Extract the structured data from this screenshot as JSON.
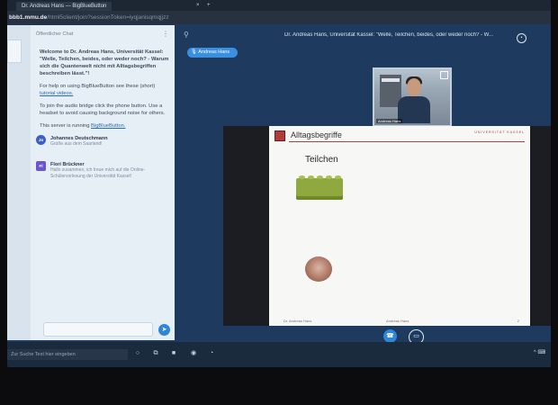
{
  "browser": {
    "tab_title": "Dr. Andreas Hans — BigBlueButton",
    "tab_close": "×",
    "new_tab": "+",
    "url_host": "bbb1.mmu.de",
    "url_path": "/html5client/join?sessionToken=iyqjanisqmqjjzz"
  },
  "chat": {
    "header": "Öffentlicher Chat",
    "menu_icon": "⋮",
    "welcome_intro": "Welcome to Dr. Andreas Hans, Universität Kassel: \"Welle, Teilchen, beides, oder weder noch? - Warum sich die Quantenwelt nicht mit Alltagsbegriffen beschreiben lässt.\"!",
    "help_prefix": "For help on using BigBlueButton see these (short)",
    "help_link": "tutorial videos.",
    "audio_tip": "To join the audio bridge click the phone button. Use a headset to avoid causing background noise for others.",
    "server_prefix": "This server is running",
    "server_link": "BigBlueButton.",
    "messages": [
      {
        "avatar": "Jo",
        "name": "Johannes Deutschmann",
        "text": "Grüße aus dem Saarland!",
        "color": "#3b5fc9"
      },
      {
        "avatar": "Fl",
        "name": "Flori Brückner",
        "text": "Hallo zusammen, ich freue mich auf die Online-Schülervorlesung der Universität Kassel!",
        "color": "#6b56cf"
      }
    ],
    "send_icon": "➤"
  },
  "main": {
    "user_icon": "⚲",
    "meeting_title": "Dr. Andreas Hans, Universität Kassel: \"Welle, Teilchen, beides, oder weder noch? - W...",
    "settings_icon": "•",
    "talker": "🎙 Andreas Hans",
    "webcam_caption": "Andreas Hans",
    "slide": {
      "title": "Alltagsbegriffe",
      "university": "UNIVERSITÄT KASSEL",
      "subtitle": "Teilchen",
      "footer_left": "Dr. Andreas Hans",
      "footer_mid": "Andreas Hans",
      "footer_right": "2"
    },
    "audio_icon": "☎",
    "screenshare_icon": "▭"
  },
  "taskbar": {
    "search_placeholder": "Zur Suche Text hier eingeben",
    "icons": [
      "○",
      "⧉",
      "■",
      "◉",
      "◔"
    ],
    "tray": "^ ⌨"
  },
  "colors": {
    "accent": "#2f86d6",
    "panel_bg": "#e6eef6",
    "main_bg": "#1e3a5e",
    "slide_red": "#c23b3b"
  }
}
